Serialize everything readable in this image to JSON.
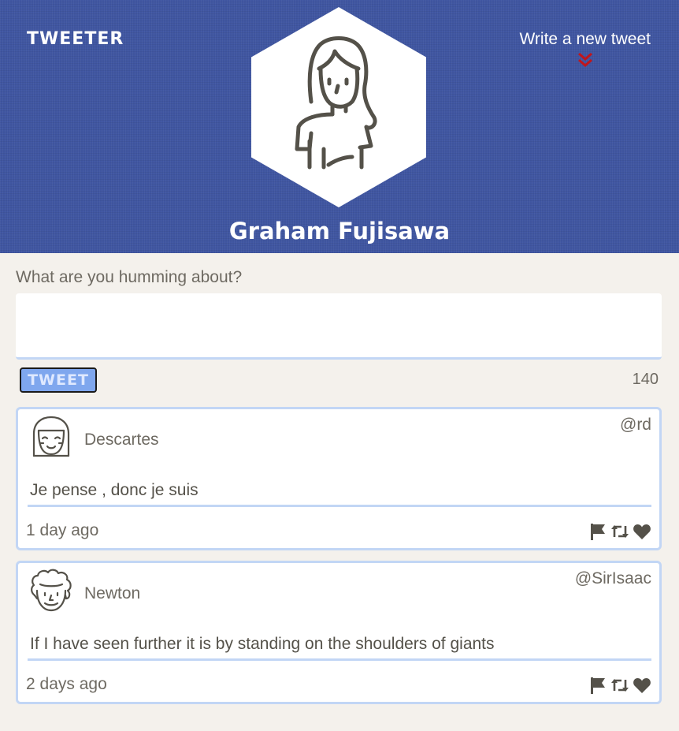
{
  "header": {
    "brand": "TWEETER",
    "compose_link": "Write a new tweet",
    "user_name": "Graham Fujisawa"
  },
  "composer": {
    "label": "What are you humming about?",
    "input_value": "",
    "button_label": "TWEET",
    "char_count": "140"
  },
  "tweets": [
    {
      "name": "Descartes",
      "handle": "@rd",
      "text": "Je pense , donc je suis",
      "time": "1 day ago",
      "avatar_icon": "girl-face-icon"
    },
    {
      "name": "Newton",
      "handle": "@SirIsaac",
      "text": "If I have seen further it is by standing on the shoulders of giants",
      "time": "2 days ago",
      "avatar_icon": "curly-hair-face-icon"
    }
  ],
  "colors": {
    "header_bg": "#4056a1",
    "page_bg": "#f4f1ec",
    "accent_blue": "#c2d6f5",
    "button_bg": "#7fa7ee",
    "chevron_red": "#c0161c",
    "icon_dark": "#545149"
  }
}
